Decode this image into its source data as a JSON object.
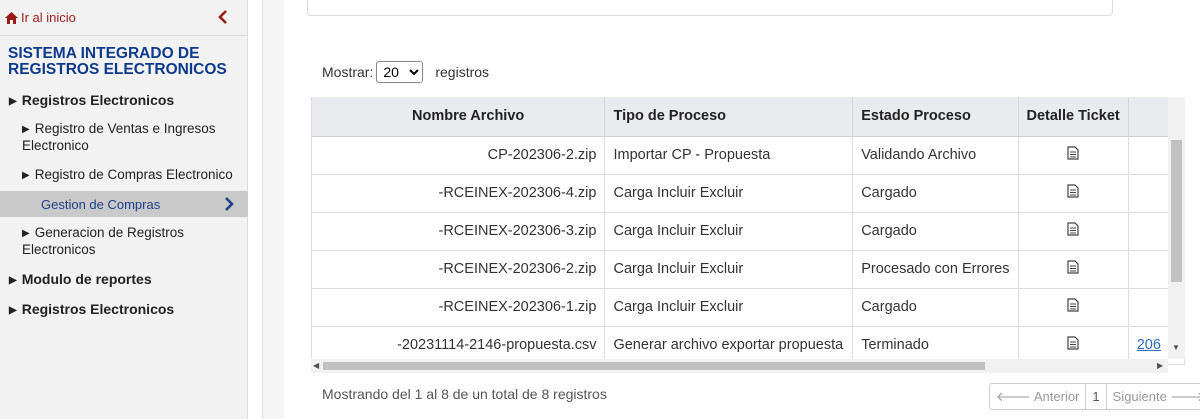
{
  "sidebar": {
    "home_label": "Ir al inicio",
    "system_title": "SISTEMA INTEGRADO DE REGISTROS ELECTRONICOS",
    "items": [
      {
        "label": "Registros Electronicos"
      },
      {
        "label": "Registro de Ventas e Ingresos Electronico"
      },
      {
        "label": "Registro de Compras Electronico"
      },
      {
        "label": "Gestion de Compras"
      },
      {
        "label": "Generacion de Registros Electronicos"
      },
      {
        "label": "Modulo de reportes"
      },
      {
        "label": "Registros Electronicos"
      }
    ]
  },
  "table_controls": {
    "show_label": "Mostrar:",
    "page_size": "20",
    "records_label": "registros"
  },
  "table": {
    "columns": [
      "Nombre Archivo",
      "Tipo de Proceso",
      "Estado Proceso",
      "Detalle Ticket"
    ],
    "rows": [
      {
        "file": "CP-202306-2.zip",
        "process": "Importar CP - Propuesta",
        "status": "Validando Archivo"
      },
      {
        "file": "-RCEINEX-202306-4.zip",
        "process": "Carga Incluir Excluir",
        "status": "Cargado"
      },
      {
        "file": "-RCEINEX-202306-3.zip",
        "process": "Carga Incluir Excluir",
        "status": "Cargado"
      },
      {
        "file": "-RCEINEX-202306-2.zip",
        "process": "Carga Incluir Excluir",
        "status": "Procesado con Errores"
      },
      {
        "file": "-RCEINEX-202306-1.zip",
        "process": "Carga Incluir Excluir",
        "status": "Cargado"
      },
      {
        "file": "-20231114-2146-propuesta.csv",
        "process": "Generar archivo exportar propuesta",
        "status": "Terminado",
        "extra": "206"
      }
    ]
  },
  "footer": {
    "info": "Mostrando del 1 al 8 de un total de 8 registros",
    "prev": "Anterior",
    "page": "1",
    "next": "Siguiente"
  },
  "colors": {
    "accent_red": "#9b1b1b",
    "title_blue": "#0d3a8c",
    "link_blue": "#2a6ebd"
  },
  "icons": [
    "home-icon",
    "chevron-left-icon",
    "chevron-right-icon",
    "document-icon",
    "arrow-left-icon",
    "arrow-right-icon"
  ]
}
